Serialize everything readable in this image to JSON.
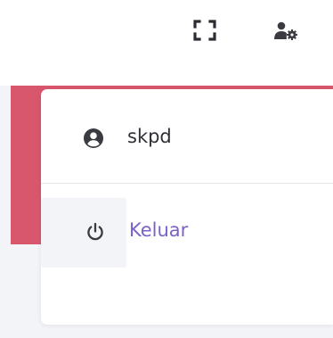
{
  "topbar": {
    "fullscreen_icon": "fullscreen-icon",
    "settings_icon": "user-cog-icon"
  },
  "user_menu": {
    "username": "skpd",
    "user_icon": "user-circle-icon",
    "logout_label": "Keluar",
    "logout_icon": "power-icon"
  },
  "colors": {
    "accent_band": "#d9576d",
    "logout_text": "#7b61c9",
    "icon_dark": "#3a3b40"
  }
}
